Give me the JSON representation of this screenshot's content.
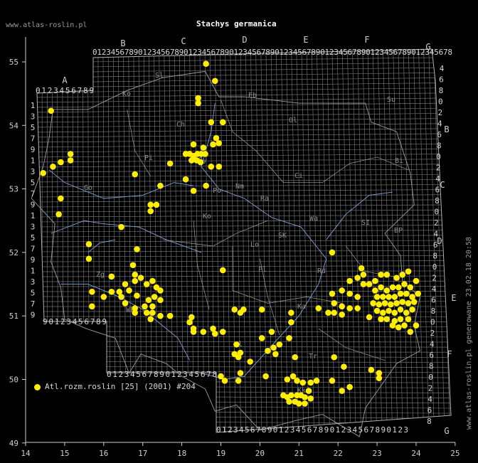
{
  "title": "Stachys germanica",
  "website": "www.atlas-roslin.pl",
  "footer_vertical": "www.atlas-roslin.pl generowane 23.02.18 20:58",
  "legend": {
    "label": "Atl.rozm.roslin [25] (2001) #204",
    "color": "#ffee00"
  },
  "colors": {
    "background": "#000000",
    "grid": "#6e6e6e",
    "border": "#b0b0b0",
    "rivers": "#7f9fd8",
    "regions": "#9c9c9c",
    "point": "#ffee00"
  },
  "axes": {
    "x_ticks": [
      "14",
      "15",
      "16",
      "17",
      "18",
      "19",
      "20",
      "21",
      "22",
      "23",
      "24",
      "25"
    ],
    "y_ticks": [
      "55",
      "54",
      "53",
      "52",
      "51",
      "50",
      "49"
    ]
  },
  "grid_letters": [
    "A",
    "B",
    "C",
    "D",
    "E",
    "F",
    "G"
  ],
  "column_digit_strings": {
    "top_B_to_G": "0123456789012345678901234567890123456789012345678901234567890123456789012345678",
    "top_A": "0123456789",
    "left_A_lower": "90123456789",
    "bottom_B": "0123456789012345678",
    "bottom_D": "0123456789012345678901234567890123"
  },
  "row_digits_left": [
    "1",
    "3",
    "5",
    "7",
    "9",
    "1",
    "3",
    "5",
    "7",
    "9",
    "1",
    "3",
    "5",
    "7",
    "9",
    "1",
    "3",
    "5",
    "7",
    "9"
  ],
  "row_digits_right": [
    "4",
    "6",
    "8",
    "0",
    "2",
    "4",
    "6",
    "8",
    "0",
    "2",
    "4",
    "6",
    "8",
    "0",
    "2",
    "4",
    "6",
    "8",
    "0",
    "2",
    "4",
    "6",
    "8",
    "0",
    "2",
    "4",
    "6",
    "8",
    "0",
    "2",
    "4",
    "6",
    "8"
  ],
  "region_labels": [
    "Sl",
    "Ko",
    "Eb",
    "Ch",
    "Ol",
    "Su",
    "Pi",
    "By",
    "Ci",
    "Bi",
    "Po",
    "Ra",
    "Ko",
    "SI",
    "BP",
    "Wa",
    "Lo",
    "SK",
    "Rd",
    "Pl",
    "Ka",
    "Zg",
    "Wk",
    "Kl",
    "Tr",
    "Kk",
    "Go",
    "Nm"
  ],
  "occurrences": [
    {
      "lon": 18.62,
      "lat": 54.97
    },
    {
      "lon": 18.85,
      "lat": 54.7
    },
    {
      "lon": 14.65,
      "lat": 54.23
    },
    {
      "lon": 18.42,
      "lat": 54.43
    },
    {
      "lon": 18.42,
      "lat": 54.35
    },
    {
      "lon": 18.75,
      "lat": 54.05
    },
    {
      "lon": 19.05,
      "lat": 54.05
    },
    {
      "lon": 18.3,
      "lat": 53.7
    },
    {
      "lon": 18.55,
      "lat": 53.65
    },
    {
      "lon": 18.88,
      "lat": 53.8
    },
    {
      "lon": 18.95,
      "lat": 53.72
    },
    {
      "lon": 18.8,
      "lat": 53.7
    },
    {
      "lon": 18.1,
      "lat": 53.55
    },
    {
      "lon": 18.2,
      "lat": 53.55
    },
    {
      "lon": 18.3,
      "lat": 53.52
    },
    {
      "lon": 18.4,
      "lat": 53.55
    },
    {
      "lon": 18.5,
      "lat": 53.55
    },
    {
      "lon": 18.6,
      "lat": 53.55
    },
    {
      "lon": 18.25,
      "lat": 53.45
    },
    {
      "lon": 18.38,
      "lat": 53.45
    },
    {
      "lon": 18.48,
      "lat": 53.42
    },
    {
      "lon": 17.7,
      "lat": 53.4
    },
    {
      "lon": 18.75,
      "lat": 53.35
    },
    {
      "lon": 18.95,
      "lat": 53.35
    },
    {
      "lon": 15.15,
      "lat": 53.55
    },
    {
      "lon": 15.15,
      "lat": 53.45
    },
    {
      "lon": 14.9,
      "lat": 53.42
    },
    {
      "lon": 14.7,
      "lat": 53.35
    },
    {
      "lon": 14.45,
      "lat": 53.25
    },
    {
      "lon": 16.8,
      "lat": 53.23
    },
    {
      "lon": 18.1,
      "lat": 53.15
    },
    {
      "lon": 17.45,
      "lat": 53.05
    },
    {
      "lon": 18.62,
      "lat": 53.05
    },
    {
      "lon": 18.3,
      "lat": 52.97
    },
    {
      "lon": 14.9,
      "lat": 52.85
    },
    {
      "lon": 17.2,
      "lat": 52.75
    },
    {
      "lon": 17.35,
      "lat": 52.75
    },
    {
      "lon": 17.2,
      "lat": 52.65
    },
    {
      "lon": 14.85,
      "lat": 52.6
    },
    {
      "lon": 16.45,
      "lat": 52.4
    },
    {
      "lon": 15.62,
      "lat": 52.13
    },
    {
      "lon": 16.85,
      "lat": 52.05
    },
    {
      "lon": 15.62,
      "lat": 51.9
    },
    {
      "lon": 16.75,
      "lat": 51.8
    },
    {
      "lon": 16.2,
      "lat": 51.62
    },
    {
      "lon": 16.8,
      "lat": 51.65
    },
    {
      "lon": 16.8,
      "lat": 51.55
    },
    {
      "lon": 16.95,
      "lat": 51.6
    },
    {
      "lon": 17.25,
      "lat": 51.55
    },
    {
      "lon": 16.55,
      "lat": 51.5
    },
    {
      "lon": 17.1,
      "lat": 51.5
    },
    {
      "lon": 17.35,
      "lat": 51.45
    },
    {
      "lon": 17.45,
      "lat": 51.4
    },
    {
      "lon": 16.65,
      "lat": 51.4
    },
    {
      "lon": 15.7,
      "lat": 51.38
    },
    {
      "lon": 16.2,
      "lat": 51.38
    },
    {
      "lon": 16.4,
      "lat": 51.38
    },
    {
      "lon": 16.85,
      "lat": 51.32
    },
    {
      "lon": 16.45,
      "lat": 51.3
    },
    {
      "lon": 17.3,
      "lat": 51.3
    },
    {
      "lon": 17.45,
      "lat": 51.25
    },
    {
      "lon": 16.0,
      "lat": 51.3
    },
    {
      "lon": 16.55,
      "lat": 51.2
    },
    {
      "lon": 17.15,
      "lat": 51.25
    },
    {
      "lon": 17.05,
      "lat": 51.15
    },
    {
      "lon": 17.25,
      "lat": 51.15
    },
    {
      "lon": 15.7,
      "lat": 51.15
    },
    {
      "lon": 16.8,
      "lat": 51.12
    },
    {
      "lon": 16.8,
      "lat": 51.05
    },
    {
      "lon": 17.1,
      "lat": 51.05
    },
    {
      "lon": 17.25,
      "lat": 51.05
    },
    {
      "lon": 17.45,
      "lat": 51.0
    },
    {
      "lon": 17.7,
      "lat": 51.0
    },
    {
      "lon": 17.2,
      "lat": 50.95
    },
    {
      "lon": 18.25,
      "lat": 50.98
    },
    {
      "lon": 18.2,
      "lat": 50.9
    },
    {
      "lon": 18.3,
      "lat": 50.8
    },
    {
      "lon": 18.3,
      "lat": 50.75
    },
    {
      "lon": 18.55,
      "lat": 50.75
    },
    {
      "lon": 18.8,
      "lat": 50.8
    },
    {
      "lon": 18.85,
      "lat": 50.72
    },
    {
      "lon": 19.05,
      "lat": 50.75
    },
    {
      "lon": 19.35,
      "lat": 51.1
    },
    {
      "lon": 19.5,
      "lat": 51.05
    },
    {
      "lon": 19.58,
      "lat": 51.1
    },
    {
      "lon": 20.05,
      "lat": 51.1
    },
    {
      "lon": 19.05,
      "lat": 51.72
    },
    {
      "lon": 19.4,
      "lat": 50.55
    },
    {
      "lon": 19.35,
      "lat": 50.4
    },
    {
      "lon": 19.45,
      "lat": 50.35
    },
    {
      "lon": 19.5,
      "lat": 50.42
    },
    {
      "lon": 19.75,
      "lat": 50.28
    },
    {
      "lon": 20.05,
      "lat": 50.65
    },
    {
      "lon": 20.2,
      "lat": 50.45
    },
    {
      "lon": 20.35,
      "lat": 50.5
    },
    {
      "lon": 20.4,
      "lat": 50.4
    },
    {
      "lon": 20.3,
      "lat": 50.75
    },
    {
      "lon": 20.5,
      "lat": 50.55
    },
    {
      "lon": 20.8,
      "lat": 51.05
    },
    {
      "lon": 20.8,
      "lat": 50.9
    },
    {
      "lon": 20.75,
      "lat": 50.65
    },
    {
      "lon": 20.9,
      "lat": 50.35
    },
    {
      "lon": 19.0,
      "lat": 50.05
    },
    {
      "lon": 19.1,
      "lat": 49.98
    },
    {
      "lon": 19.45,
      "lat": 49.98
    },
    {
      "lon": 19.5,
      "lat": 50.1
    },
    {
      "lon": 20.15,
      "lat": 50.05
    },
    {
      "lon": 20.7,
      "lat": 50.0
    },
    {
      "lon": 20.85,
      "lat": 50.05
    },
    {
      "lon": 20.95,
      "lat": 49.98
    },
    {
      "lon": 21.1,
      "lat": 49.95
    },
    {
      "lon": 21.3,
      "lat": 49.95
    },
    {
      "lon": 20.6,
      "lat": 49.75
    },
    {
      "lon": 20.7,
      "lat": 49.72
    },
    {
      "lon": 20.8,
      "lat": 49.75
    },
    {
      "lon": 20.95,
      "lat": 49.75
    },
    {
      "lon": 21.05,
      "lat": 49.75
    },
    {
      "lon": 21.15,
      "lat": 49.72
    },
    {
      "lon": 20.9,
      "lat": 49.65
    },
    {
      "lon": 21.0,
      "lat": 49.62
    },
    {
      "lon": 21.15,
      "lat": 49.62
    },
    {
      "lon": 20.75,
      "lat": 49.65
    },
    {
      "lon": 21.25,
      "lat": 49.82
    },
    {
      "lon": 21.45,
      "lat": 49.98
    },
    {
      "lon": 21.3,
      "lat": 49.7
    },
    {
      "lon": 21.85,
      "lat": 49.98
    },
    {
      "lon": 22.1,
      "lat": 49.82
    },
    {
      "lon": 22.3,
      "lat": 49.88
    },
    {
      "lon": 21.9,
      "lat": 50.35
    },
    {
      "lon": 22.15,
      "lat": 50.2
    },
    {
      "lon": 22.85,
      "lat": 50.15
    },
    {
      "lon": 23.05,
      "lat": 50.1
    },
    {
      "lon": 23.05,
      "lat": 50.02
    },
    {
      "lon": 21.5,
      "lat": 51.12
    },
    {
      "lon": 21.75,
      "lat": 51.05
    },
    {
      "lon": 21.9,
      "lat": 51.05
    },
    {
      "lon": 22.1,
      "lat": 51.02
    },
    {
      "lon": 21.9,
      "lat": 51.2
    },
    {
      "lon": 22.1,
      "lat": 51.15
    },
    {
      "lon": 22.3,
      "lat": 51.12
    },
    {
      "lon": 22.5,
      "lat": 51.12
    },
    {
      "lon": 21.85,
      "lat": 51.35
    },
    {
      "lon": 22.1,
      "lat": 51.4
    },
    {
      "lon": 22.3,
      "lat": 51.35
    },
    {
      "lon": 22.5,
      "lat": 51.3
    },
    {
      "lon": 22.3,
      "lat": 51.55
    },
    {
      "lon": 22.5,
      "lat": 51.6
    },
    {
      "lon": 22.65,
      "lat": 51.5
    },
    {
      "lon": 22.8,
      "lat": 51.5
    },
    {
      "lon": 22.65,
      "lat": 51.65
    },
    {
      "lon": 22.95,
      "lat": 51.55
    },
    {
      "lon": 23.1,
      "lat": 51.65
    },
    {
      "lon": 23.25,
      "lat": 51.65
    },
    {
      "lon": 23.5,
      "lat": 51.6
    },
    {
      "lon": 23.65,
      "lat": 51.65
    },
    {
      "lon": 23.8,
      "lat": 51.7
    },
    {
      "lon": 22.95,
      "lat": 51.4
    },
    {
      "lon": 23.1,
      "lat": 51.45
    },
    {
      "lon": 23.25,
      "lat": 51.4
    },
    {
      "lon": 23.4,
      "lat": 51.45
    },
    {
      "lon": 23.55,
      "lat": 51.45
    },
    {
      "lon": 23.7,
      "lat": 51.5
    },
    {
      "lon": 23.85,
      "lat": 51.45
    },
    {
      "lon": 24.0,
      "lat": 51.55
    },
    {
      "lon": 23.0,
      "lat": 51.3
    },
    {
      "lon": 23.15,
      "lat": 51.3
    },
    {
      "lon": 23.3,
      "lat": 51.3
    },
    {
      "lon": 23.45,
      "lat": 51.3
    },
    {
      "lon": 23.6,
      "lat": 51.35
    },
    {
      "lon": 23.75,
      "lat": 51.35
    },
    {
      "lon": 23.9,
      "lat": 51.3
    },
    {
      "lon": 24.05,
      "lat": 51.35
    },
    {
      "lon": 22.9,
      "lat": 51.2
    },
    {
      "lon": 23.05,
      "lat": 51.18
    },
    {
      "lon": 23.2,
      "lat": 51.2
    },
    {
      "lon": 23.35,
      "lat": 51.18
    },
    {
      "lon": 23.5,
      "lat": 51.2
    },
    {
      "lon": 23.65,
      "lat": 51.22
    },
    {
      "lon": 23.8,
      "lat": 51.2
    },
    {
      "lon": 23.95,
      "lat": 51.22
    },
    {
      "lon": 23.0,
      "lat": 51.08
    },
    {
      "lon": 23.15,
      "lat": 51.05
    },
    {
      "lon": 23.3,
      "lat": 51.08
    },
    {
      "lon": 23.45,
      "lat": 51.05
    },
    {
      "lon": 23.6,
      "lat": 51.1
    },
    {
      "lon": 23.75,
      "lat": 51.05
    },
    {
      "lon": 23.9,
      "lat": 51.1
    },
    {
      "lon": 22.8,
      "lat": 50.98
    },
    {
      "lon": 23.1,
      "lat": 50.95
    },
    {
      "lon": 23.25,
      "lat": 50.95
    },
    {
      "lon": 23.45,
      "lat": 50.92
    },
    {
      "lon": 23.6,
      "lat": 50.95
    },
    {
      "lon": 23.8,
      "lat": 50.95
    },
    {
      "lon": 23.4,
      "lat": 50.85
    },
    {
      "lon": 23.55,
      "lat": 50.82
    },
    {
      "lon": 23.7,
      "lat": 50.85
    },
    {
      "lon": 23.85,
      "lat": 50.75
    },
    {
      "lon": 24.0,
      "lat": 50.85
    },
    {
      "lon": 22.6,
      "lat": 51.75
    },
    {
      "lon": 21.85,
      "lat": 52.0
    }
  ]
}
